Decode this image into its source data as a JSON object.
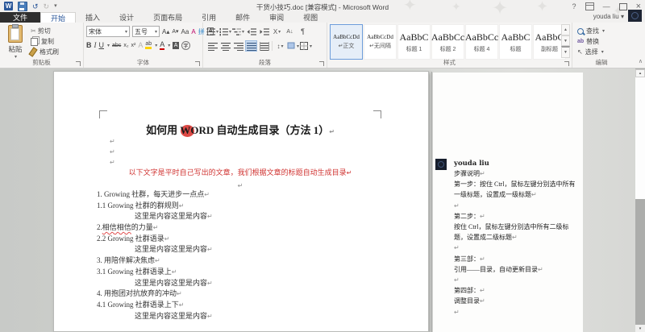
{
  "titlebar": {
    "title": "干货小技巧.doc [兼容模式] - Microsoft Word",
    "account": "youda liu"
  },
  "controls": {
    "help": "?",
    "min": "—",
    "close": "×"
  },
  "tabs": [
    "文件",
    "开始",
    "插入",
    "设计",
    "页面布局",
    "引用",
    "邮件",
    "审阅",
    "视图"
  ],
  "icons": {
    "word_logo": "W",
    "undo": "↺",
    "redo": "↻",
    "qat_more": "▾",
    "dropdown": "▾",
    "cut": "✂",
    "bold": "B",
    "italic": "I",
    "underline": "U",
    "strike": "abc",
    "subscript": "x₂",
    "superscript": "x²",
    "grow_font": "A▴",
    "shrink_font": "A▾",
    "change_case": "Aa",
    "clear_format": "A",
    "phonetic": "拼",
    "char_border": "A",
    "text_effects": "A",
    "highlight": "ab",
    "font_color": "A",
    "char_shading": "A",
    "enclose": "字",
    "cjk_layout": "X",
    "sort": "A↓",
    "marks": "¶",
    "line_spacing": "↕",
    "select_arrow": "↖",
    "scroll_up": "▲",
    "scroll_down": "▼",
    "scroll_more": "▼",
    "vscroll_top": "▴",
    "vscroll_bottom": "▾"
  },
  "ribbon": {
    "clipboard": {
      "label": "剪贴板",
      "paste": "粘贴",
      "cut": "剪切",
      "copy": "复制",
      "format_painter": "格式刷"
    },
    "font": {
      "label": "字体",
      "name": "宋体",
      "size": "五号"
    },
    "paragraph": {
      "label": "段落"
    },
    "styles": {
      "label": "样式",
      "items": [
        {
          "sample": "AaBbCcDd",
          "label": "↵正文",
          "selected": true
        },
        {
          "sample": "AaBbCcDd",
          "label": "↵无间隔"
        },
        {
          "sample": "AaBbC",
          "label": "标题 1"
        },
        {
          "sample": "AaBbCc",
          "label": "标题 2"
        },
        {
          "sample": "AaBbCc",
          "label": "标题 4"
        },
        {
          "sample": "AaBbC",
          "label": "标题"
        },
        {
          "sample": "AaBbC",
          "label": "副标题"
        }
      ]
    },
    "editing": {
      "label": "编辑",
      "find": "查找",
      "replace": "替换",
      "select": "选择"
    }
  },
  "document": {
    "pilcrow": "↵",
    "title": {
      "pre": "如何用 ",
      "word": "WORD",
      "post": " 自动生成目录（方法 1）"
    },
    "intro": "以下文字是平时自己写出的文章，我们根据文章的标题自动生成目录",
    "lines": [
      {
        "text": "1. Growing 社群，每天进步一点点"
      },
      {
        "text": "1.1 Growing 社群的群规则"
      },
      {
        "text": "这里是内容这里是内容"
      },
      {
        "pre": "2.",
        "squiggly": "相信相信",
        "post": "的力量"
      },
      {
        "text": "2.2 Growing 社群语录"
      },
      {
        "text": "这里是内容这里是内容"
      },
      {
        "text": "3. 用陪伴解决焦虑"
      },
      {
        "text": "3.1 Growing 社群语录上"
      },
      {
        "text": "这里是内容这里是内容"
      },
      {
        "text": "4. 用抱团对抗放弃的冲动"
      },
      {
        "text": "4.1 Growing 社群语录上下"
      },
      {
        "text": "这里是内容这里是内容"
      }
    ]
  },
  "comments": {
    "author": "youda liu",
    "lines": [
      "步骤说明",
      "第一步：按住 Ctrl，鼠标左键分别选中所有一级标题，设置成一级标题",
      "",
      "第二步：",
      "按住 Ctrl，鼠标左键分别选中所有二级标题，设置成二级标题",
      "",
      "第三部：",
      "引用——目录，自动更新目录",
      "",
      "第四部：",
      "调整目录",
      ""
    ]
  }
}
